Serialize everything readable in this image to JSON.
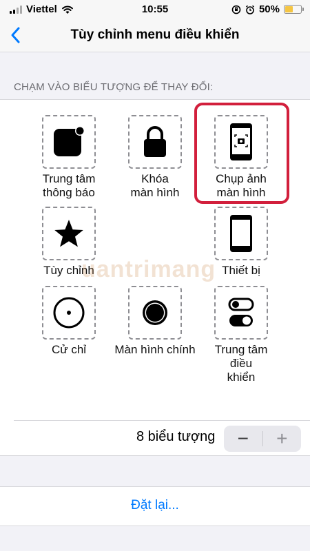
{
  "status_bar": {
    "carrier": "Viettel",
    "time": "10:55",
    "battery_text": "50%",
    "battery_level": 0.5,
    "battery_color": "#f5c542",
    "icons": [
      "signal-icon",
      "wifi-icon",
      "orientation-lock-icon",
      "alarm-icon",
      "battery-icon"
    ]
  },
  "nav": {
    "title": "Tùy chỉnh menu điều khiển",
    "back_icon": "chevron-left-icon"
  },
  "section_header": "CHẠM VÀO BIỂU TƯỢNG ĐỂ THAY ĐỔI:",
  "grid": {
    "items": [
      {
        "label": "Trung tâm\nthông báo",
        "icon": "notification-center-icon"
      },
      {
        "label": "Khóa\nmàn hình",
        "icon": "lock-icon"
      },
      {
        "label": "Chụp ảnh\nmàn hình",
        "icon": "screenshot-icon",
        "highlighted": true
      },
      {
        "label": "Tùy chỉnh",
        "icon": "star-icon"
      },
      {
        "label": "Thiết bị",
        "icon": "device-icon"
      },
      {
        "label": "Cử chỉ",
        "icon": "gesture-icon"
      },
      {
        "label": "Màn hình chính",
        "icon": "home-icon"
      },
      {
        "label": "Trung tâm\nđiều\nkhiển",
        "icon": "control-center-icon"
      }
    ],
    "highlight_color": "#d21f3c"
  },
  "watermark": "uantrimang",
  "counter": {
    "label": "8 biểu tượng",
    "minus": "−",
    "plus": "+"
  },
  "reset": {
    "label": "Đặt lại..."
  },
  "colors": {
    "accent": "#007aff",
    "background": "#f2f2f7"
  }
}
